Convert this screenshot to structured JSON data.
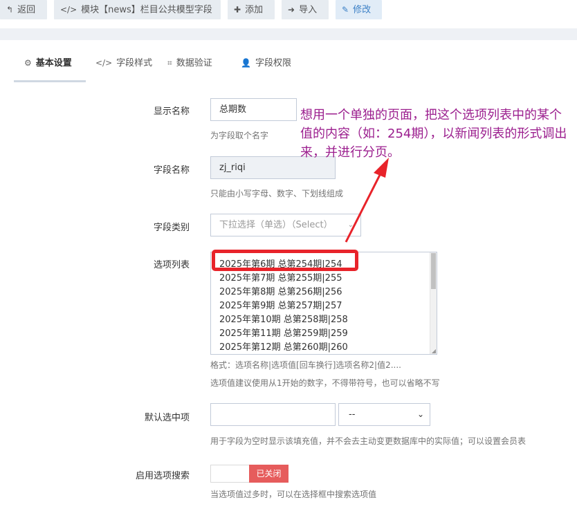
{
  "toolbar": {
    "back": "返回",
    "module_model": "模块【news】栏目公共模型字段",
    "add": "添加",
    "import": "导入",
    "edit": "修改"
  },
  "tabs": {
    "basic": "基本设置",
    "style": "字段样式",
    "validate": "数据验证",
    "permission": "字段权限"
  },
  "form": {
    "display_name": {
      "label": "显示名称",
      "value": "总期数",
      "help": "为字段取个名字"
    },
    "field_name": {
      "label": "字段名称",
      "value": "zj_riqi",
      "help": "只能由小写字母、数字、下划线组成"
    },
    "field_type": {
      "label": "字段类别",
      "value": "下拉选择（单选）（Select）"
    },
    "options": {
      "label": "选项列表",
      "lines": [
        "2025年第6期  总第254期|254",
        "2025年第7期  总第255期|255",
        "2025年第8期  总第256期|256",
        "2025年第9期  总第257期|257",
        "2025年第10期  总第258期|258",
        "2025年第11期 总第259期|259",
        "2025年第12期 总第260期|260"
      ],
      "help1": "格式：选项名称|选项值[回车换行]选项名称2|值2....",
      "help2": "选项值建议使用从1开始的数字，不得带符号，也可以省略不写"
    },
    "default": {
      "label": "默认选中项",
      "value": "",
      "select_value": "--",
      "help": "用于字段为空时显示该填充值，并不会去主动变更数据库中的实际值；可以设置会员表"
    },
    "search": {
      "label": "启用选项搜索",
      "toggle": "已关闭",
      "help": "当选项值过多时，可以在选择框中搜索选项值"
    }
  },
  "annotation": "想用一个单独的页面，把这个选项列表中的某个值的内容（如：254期），以新闻列表的形式调出来，并进行分页。",
  "colors": {
    "annotation": "#9b1e8e",
    "highlight": "#e8232a",
    "toggle_off": "#e65c5c",
    "primary": "#3c80c6"
  }
}
